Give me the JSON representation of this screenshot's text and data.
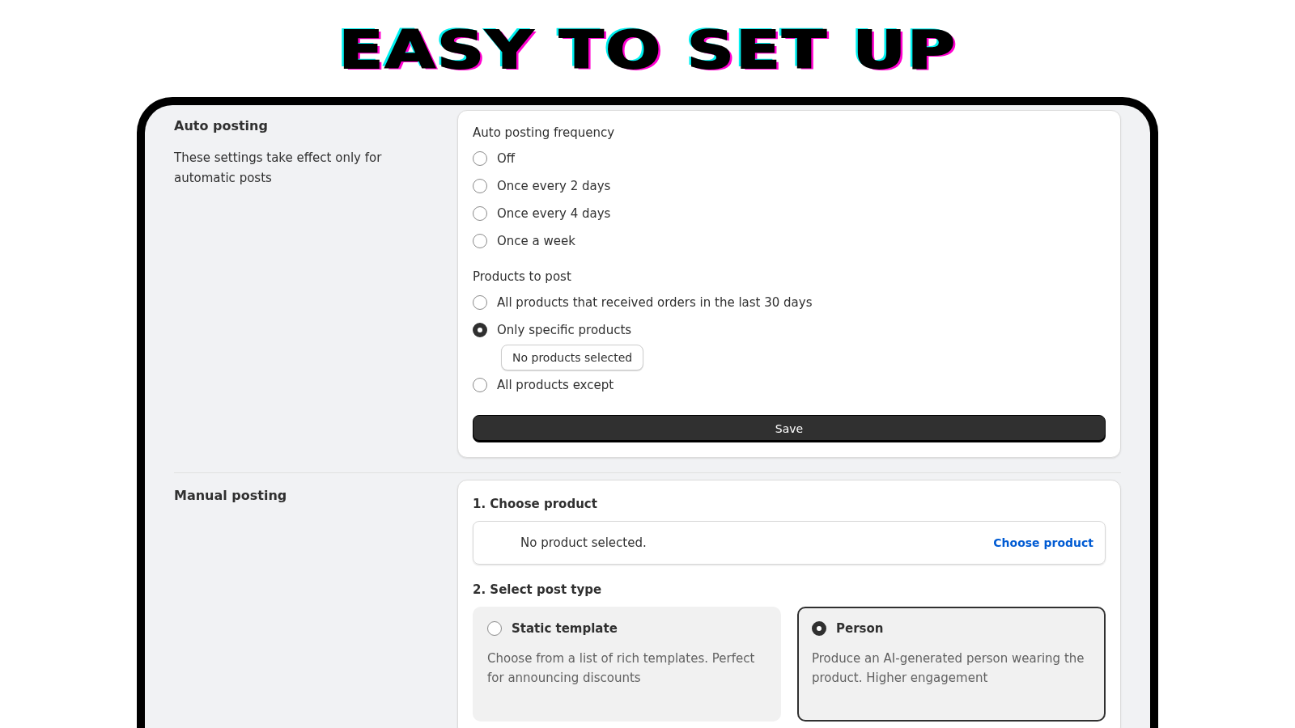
{
  "headline": "EASY TO SET UP",
  "auto_posting": {
    "title": "Auto posting",
    "description": "These settings take effect only for automatic posts",
    "frequency": {
      "label": "Auto posting frequency",
      "options": [
        {
          "label": "Off",
          "selected": false
        },
        {
          "label": "Once every 2 days",
          "selected": false
        },
        {
          "label": "Once every 4 days",
          "selected": false
        },
        {
          "label": "Once a week",
          "selected": false
        }
      ]
    },
    "products": {
      "label": "Products to post",
      "options": [
        {
          "label": "All products that received orders in the last 30 days",
          "selected": false
        },
        {
          "label": "Only specific products",
          "selected": true,
          "button": "No products selected"
        },
        {
          "label": "All products except",
          "selected": false
        }
      ]
    },
    "save_button": "Save"
  },
  "manual_posting": {
    "title": "Manual posting",
    "step_1": {
      "label": "1. Choose product",
      "empty_text": "No product selected.",
      "link": "Choose product"
    },
    "step_2": {
      "label": "2. Select post type",
      "options": [
        {
          "title": "Static template",
          "description": "Choose from a list of rich templates. Perfect for announcing discounts",
          "selected": false
        },
        {
          "title": "Person",
          "description": "Produce an AI-generated person wearing the product. Higher engagement",
          "selected": true
        }
      ]
    }
  }
}
